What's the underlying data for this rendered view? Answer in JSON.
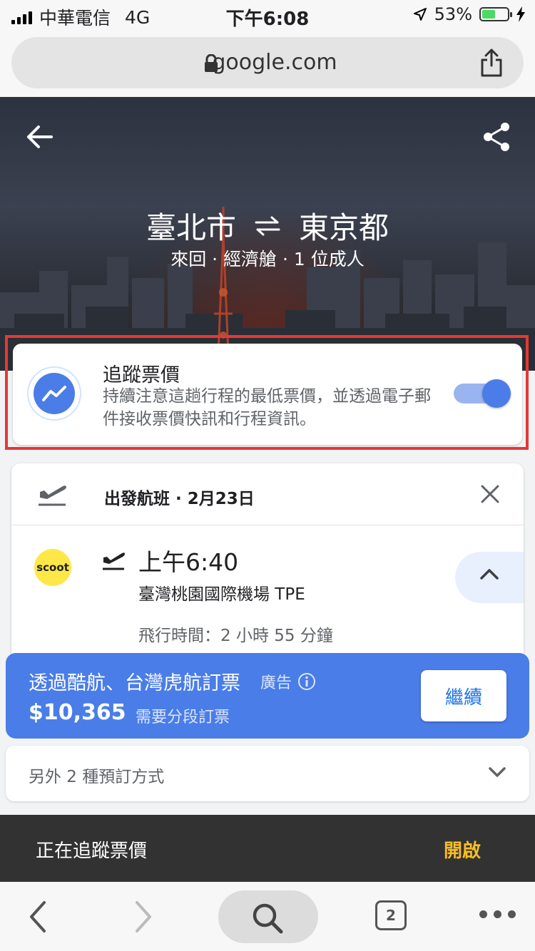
{
  "status_bar": {
    "carrier": "中華電信",
    "network": "4G",
    "time": "下午6:08",
    "battery": "53%",
    "battery_level": 0.53
  },
  "browser": {
    "url": "google.com"
  },
  "hero": {
    "origin": "臺北市",
    "destination": "東京都",
    "trip_details": "來回 · 經濟艙 · 1 位成人"
  },
  "price_tracking": {
    "title": "追蹤票價",
    "description": "持續注意這趟行程的最低票價，並透過電子郵件接收票價快訊和行程資訊。",
    "enabled": true
  },
  "flight": {
    "header": "出發航班 · 2月23日",
    "airline_logo_text": "scoot",
    "departure_time": "上午6:40",
    "departure_airport": "臺灣桃園國際機場 TPE",
    "duration": "飛行時間：2 小時 55 分鐘"
  },
  "booking": {
    "via": "透過酷航、台灣虎航訂票",
    "ad_label": "廣告",
    "price": "$10,365",
    "note": "需要分段訂票",
    "continue_label": "繼續"
  },
  "other_options": {
    "label": "另外 2 種預訂方式"
  },
  "snackbar": {
    "message": "正在追蹤票價",
    "action": "開啟"
  },
  "toolbar": {
    "tab_count": "2"
  },
  "colors": {
    "accent_blue": "#4a7de8",
    "highlight_red": "#e53935",
    "snackbar_action": "#f6bd26",
    "scoot_yellow": "#fde848"
  }
}
